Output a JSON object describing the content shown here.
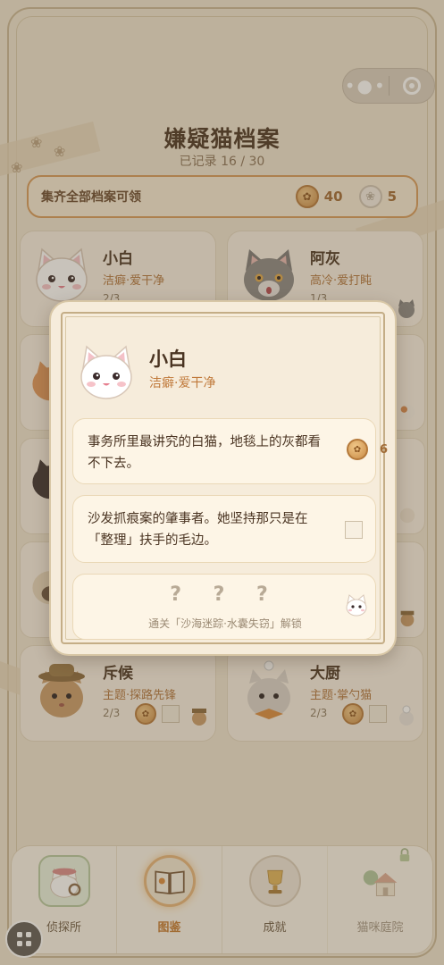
{
  "header": {
    "title": "嫌疑猫档案",
    "progress_label": "已记录 16 / 30"
  },
  "reward_bar": {
    "label": "集齐全部档案可领",
    "coin_amount": "40",
    "paw_amount": "5"
  },
  "capsule": {
    "more_icon": "more-dots-icon",
    "close_icon": "target-close-icon"
  },
  "cards": [
    {
      "name": "小白",
      "tag": "洁癖·爱干净",
      "progress": "2/3",
      "cat": "white"
    },
    {
      "name": "阿灰",
      "tag": "高冷·爱打盹",
      "progress": "1/3",
      "cat": "gray"
    },
    {
      "name": "斥候",
      "tag": "主题·探路先锋",
      "progress": "2/3",
      "cat": "explorer"
    },
    {
      "name": "大厨",
      "tag": "主题·掌勺猫",
      "progress": "2/3",
      "cat": "chef"
    }
  ],
  "modal": {
    "name": "小白",
    "tag": "洁癖·爱干净",
    "entries": [
      {
        "text": "事务所里最讲究的白猫，地毯上的灰都看不下去。",
        "reward": "6",
        "state": "reward"
      },
      {
        "text": "沙发抓痕案的肇事者。她坚持那只是在「整理」扶手的毛边。",
        "state": "empty"
      },
      {
        "masked": "? ? ?",
        "unlock_hint": "通关「沙海迷踪·水囊失窃」解锁",
        "state": "locked"
      }
    ]
  },
  "tabbar": [
    {
      "label": "侦探所",
      "icon": "detective-cat-icon",
      "active": false
    },
    {
      "label": "图鉴",
      "icon": "book-icon",
      "active": true
    },
    {
      "label": "成就",
      "icon": "trophy-icon",
      "active": false
    },
    {
      "label": "猫咪庭院",
      "icon": "house-icon",
      "active": false,
      "locked": true
    }
  ],
  "colors": {
    "accent": "#c47a30",
    "background": "#efe4d0",
    "overlay": "#5f4e37"
  }
}
